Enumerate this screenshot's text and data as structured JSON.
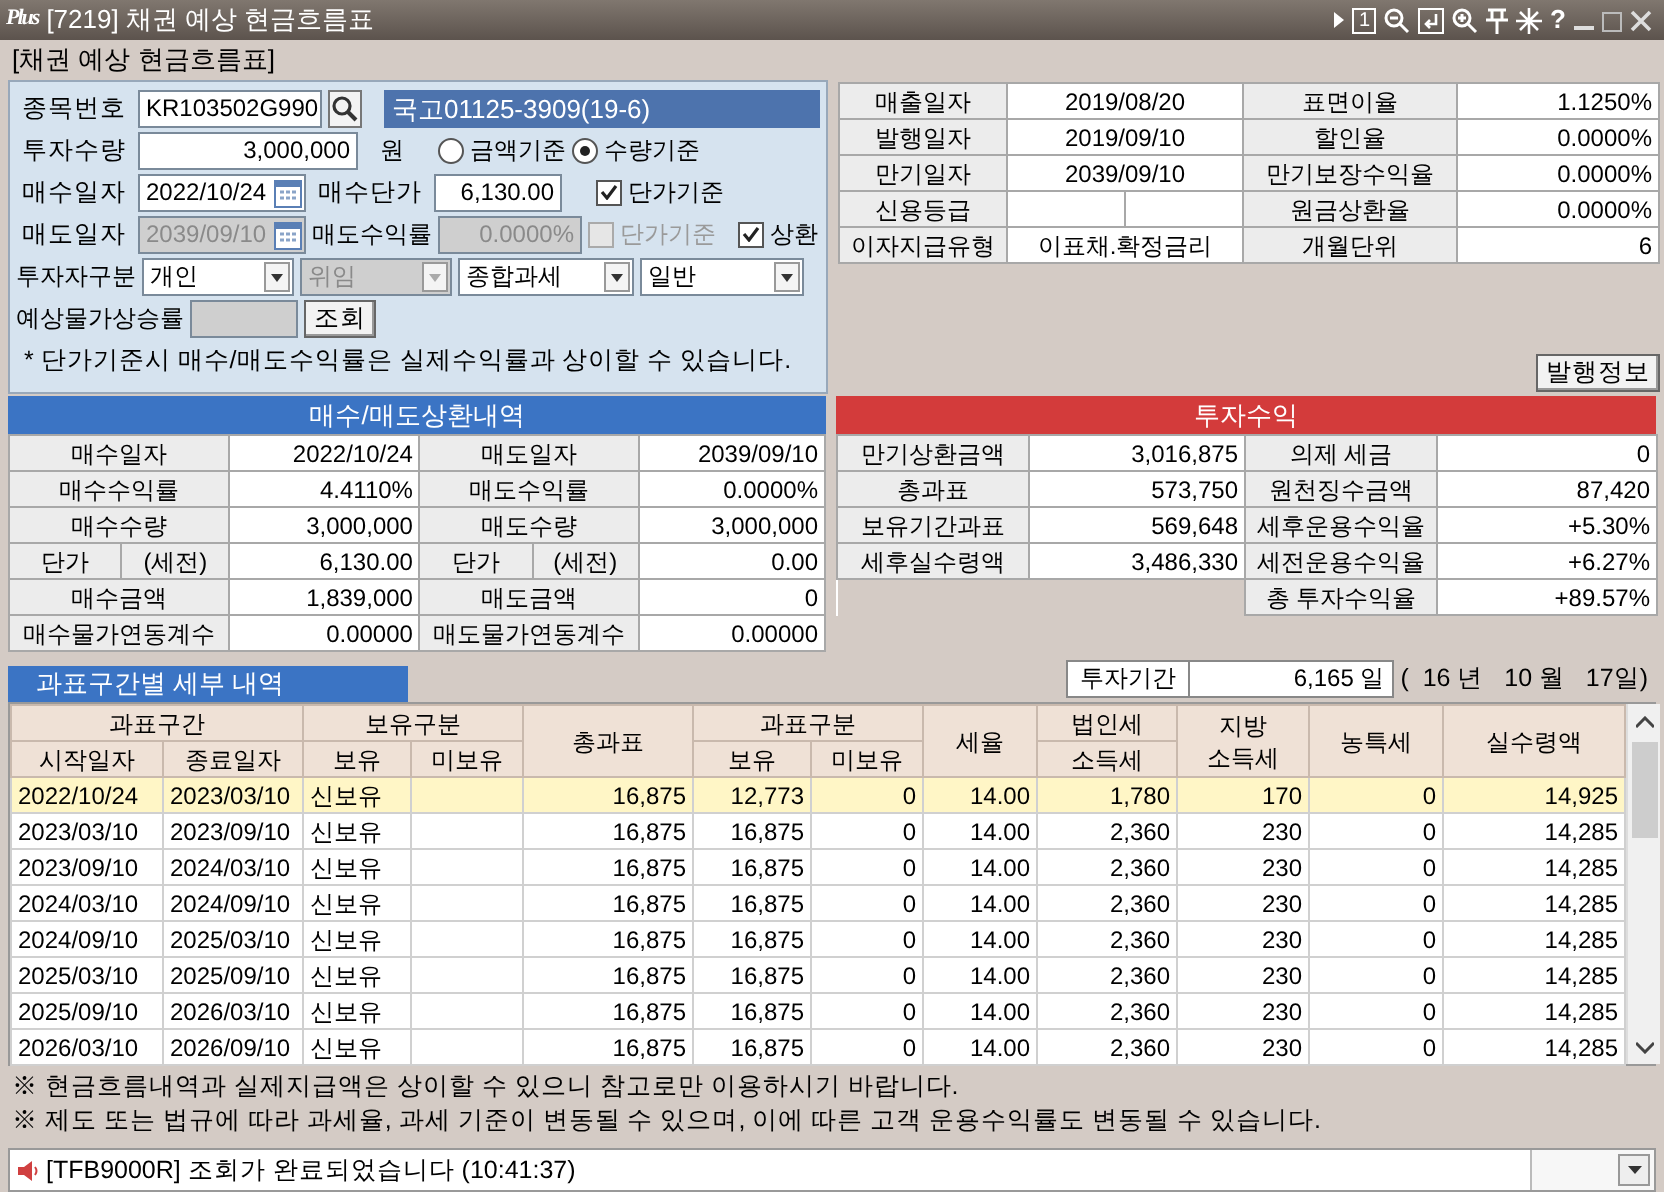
{
  "window": {
    "logo": "Plus",
    "title": "[7219] 채권 예상 현금흐름표",
    "page": "1",
    "help": "?"
  },
  "heading": "[채권 예상 현금흐름표]",
  "form": {
    "code": {
      "label": "종목번호",
      "value": "KR103502G990",
      "name": "국고01125-3909(19-6)"
    },
    "quantity": {
      "label": "투자수량",
      "value": "3,000,000",
      "unit": "원",
      "basis": [
        {
          "label": "금액기준",
          "selected": false
        },
        {
          "label": "수량기준",
          "selected": true
        }
      ]
    },
    "buy": {
      "label": "매수일자",
      "date": "2022/10/24",
      "price_label": "매수단가",
      "price": "6,130.00",
      "unit_basis": {
        "label": "단가기준",
        "checked": true
      }
    },
    "sell": {
      "label": "매도일자",
      "date": "2039/09/10",
      "disabled": true,
      "yield_label": "매도수익률",
      "yield": "0.0000%",
      "unit_basis": {
        "label": "단가기준",
        "checked": false,
        "disabled": true
      },
      "redemption": {
        "label": "상환",
        "checked": true
      }
    },
    "investor": {
      "label": "투자자구분",
      "selects": [
        {
          "value": "개인",
          "disabled": false
        },
        {
          "value": "위임",
          "disabled": true
        },
        {
          "value": "종합과세",
          "disabled": false
        },
        {
          "value": "일반",
          "disabled": false
        }
      ]
    },
    "inflation": {
      "label": "예상물가상승률",
      "disabled": true,
      "button": "조회"
    },
    "note": "* 단가기준시 매수/매도수익률은 실제수익률과 상이할 수 있습니다."
  },
  "bond_info": {
    "rows": [
      {
        "label": "매출일자",
        "value": "2019/08/20",
        "label2": "표면이율",
        "value2": "1.1250%"
      },
      {
        "label": "발행일자",
        "value": "2019/09/10",
        "label2": "할인율",
        "value2": "0.0000%"
      },
      {
        "label": "만기일자",
        "value": "2039/09/10",
        "label2": "만기보장수익율",
        "value2": "0.0000%"
      },
      {
        "label": "신용등급",
        "label2": "원금상환율",
        "value2": "0.0000%"
      },
      {
        "label": "이자지급유형",
        "value": "이표채.확정금리",
        "label2": "개월단위",
        "value2": "6"
      }
    ],
    "button": "발행정보"
  },
  "trade": {
    "title": "매수/매도상환내역",
    "rows": [
      {
        "buy_label": "매수일자",
        "buy_value": "2022/10/24",
        "sell_label": "매도일자",
        "sell_value": "2039/09/10"
      },
      {
        "buy_label": "매수수익률",
        "buy_value": "4.4110%",
        "sell_label": "매도수익률",
        "sell_value": "0.0000%"
      },
      {
        "buy_label": "매수수량",
        "buy_value": "3,000,000",
        "sell_label": "매도수량",
        "sell_value": "3,000,000"
      },
      {
        "buy_label": "단가",
        "buy_sub": "(세전)",
        "buy_value": "6,130.00",
        "sell_label": "단가",
        "sell_sub": "(세전)",
        "sell_value": "0.00"
      },
      {
        "buy_label": "매수금액",
        "buy_value": "1,839,000",
        "sell_label": "매도금액",
        "sell_value": "0"
      },
      {
        "buy_label": "매수물가연동계수",
        "buy_value": "0.00000",
        "sell_label": "매도물가연동계수",
        "sell_value": "0.00000"
      }
    ]
  },
  "returns": {
    "title": "투자수익",
    "rows": [
      {
        "label": "만기상환금액",
        "value": "3,016,875",
        "label2": "의제 세금",
        "value2": "0"
      },
      {
        "label": "총과표",
        "value": "573,750",
        "label2": "원천징수금액",
        "value2": "87,420"
      },
      {
        "label": "보유기간과표",
        "value": "569,648",
        "label2": "세후운용수익율",
        "value2": "+5.30%"
      },
      {
        "label": "세후실수령액",
        "value": "3,486,330",
        "label2": "세전운용수익율",
        "value2": "+6.27%"
      },
      {
        "label2": "총 투자수익율",
        "value2": "+89.57%"
      }
    ]
  },
  "detail": {
    "tab": "과표구간별 세부 내역",
    "period_label": "투자기간",
    "period_value": "6,165 일",
    "period_breakdown": "(  16 년   10 월   17일)"
  },
  "table": {
    "column_groups": [
      {
        "label": "과표구간",
        "columns": [
          "시작일자",
          "종료일자"
        ]
      },
      {
        "label": "보유구분",
        "columns": [
          "보유",
          "미보유"
        ]
      },
      {
        "label": "총과표"
      },
      {
        "label": "과표구분",
        "columns": [
          "보유",
          "미보유"
        ]
      },
      {
        "label": "세율"
      },
      {
        "label": "법인세",
        "columns": [
          "소득세"
        ]
      },
      {
        "label": "지방\n소득세"
      },
      {
        "label": "농특세"
      },
      {
        "label": "실수령액"
      }
    ],
    "rows": [
      {
        "selected": true,
        "cells": [
          "2022/10/24",
          "2023/03/10",
          "신보유",
          null,
          "16,875",
          "12,773",
          "0",
          "14.00",
          "1,780",
          "170",
          "0",
          "14,925"
        ]
      },
      {
        "selected": false,
        "cells": [
          "2023/03/10",
          "2023/09/10",
          "신보유",
          null,
          "16,875",
          "16,875",
          "0",
          "14.00",
          "2,360",
          "230",
          "0",
          "14,285"
        ]
      },
      {
        "selected": false,
        "cells": [
          "2023/09/10",
          "2024/03/10",
          "신보유",
          null,
          "16,875",
          "16,875",
          "0",
          "14.00",
          "2,360",
          "230",
          "0",
          "14,285"
        ]
      },
      {
        "selected": false,
        "cells": [
          "2024/03/10",
          "2024/09/10",
          "신보유",
          null,
          "16,875",
          "16,875",
          "0",
          "14.00",
          "2,360",
          "230",
          "0",
          "14,285"
        ]
      },
      {
        "selected": false,
        "cells": [
          "2024/09/10",
          "2025/03/10",
          "신보유",
          null,
          "16,875",
          "16,875",
          "0",
          "14.00",
          "2,360",
          "230",
          "0",
          "14,285"
        ]
      },
      {
        "selected": false,
        "cells": [
          "2025/03/10",
          "2025/09/10",
          "신보유",
          null,
          "16,875",
          "16,875",
          "0",
          "14.00",
          "2,360",
          "230",
          "0",
          "14,285"
        ]
      },
      {
        "selected": false,
        "cells": [
          "2025/09/10",
          "2026/03/10",
          "신보유",
          null,
          "16,875",
          "16,875",
          "0",
          "14.00",
          "2,360",
          "230",
          "0",
          "14,285"
        ]
      },
      {
        "selected": false,
        "cells": [
          "2026/03/10",
          "2026/09/10",
          "신보유",
          null,
          "16,875",
          "16,875",
          "0",
          "14.00",
          "2,360",
          "230",
          "0",
          "14,285"
        ]
      }
    ]
  },
  "notes": [
    "※ 현금흐름내역과 실제지급액은 상이할 수 있으니 참고로만 이용하시기 바랍니다.",
    "※ 제도 또는 법규에 따라 과세율, 과세 기준이 변동될 수 있으며, 이에 따른 고객 운용수익률도 변동될 수 있습니다."
  ],
  "status_bar": {
    "message": "[TFB9000R] 조회가 완료되었습니다 (10:41:37)"
  }
}
